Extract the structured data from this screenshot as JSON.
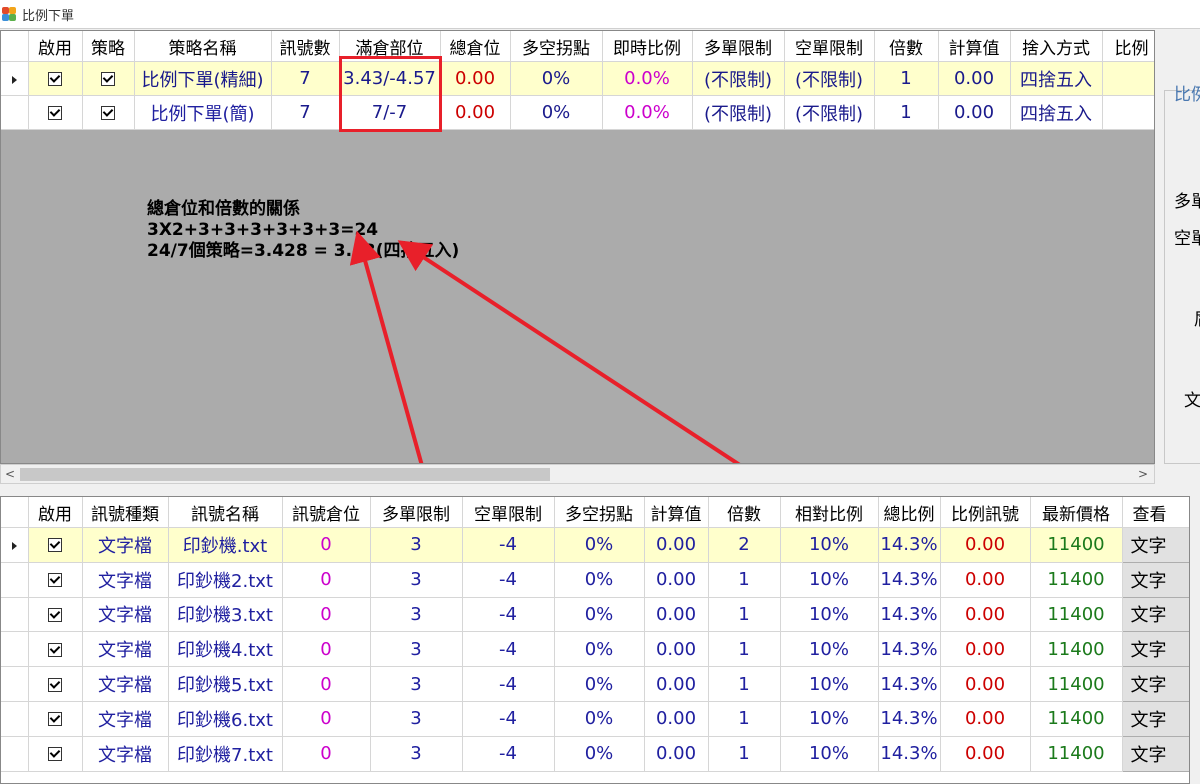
{
  "window": {
    "title": "比例下單"
  },
  "top_table": {
    "headers": [
      "啟用",
      "策略",
      "策略名稱",
      "訊號數",
      "滿倉部位",
      "總倉位",
      "多空拐點",
      "即時比例",
      "多單限制",
      "空單限制",
      "倍數",
      "計算值",
      "捨入方式",
      "比例"
    ],
    "rows": [
      [
        "",
        "",
        "比例下單(精細)",
        "7",
        "3.43/-4.57",
        "0.00",
        "0%",
        "0.0%",
        "(不限制)",
        "(不限制)",
        "1",
        "0.00",
        "四捨五入"
      ],
      [
        "",
        "",
        "比例下單(簡)",
        "7",
        "7/-7",
        "0.00",
        "0%",
        "0.0%",
        "(不限制)",
        "(不限制)",
        "1",
        "0.00",
        "四捨五入"
      ]
    ]
  },
  "annotation": {
    "line1": "總倉位和倍數的關係",
    "line2": "3X2+3+3+3+3+3+3=24",
    "line3": "24/7個策略=3.428 = 3.43(四捨五入)"
  },
  "right_panel": {
    "labels": [
      "比例",
      "多單",
      "空單",
      "屑",
      "文"
    ]
  },
  "bottom_table": {
    "headers": [
      "啟用",
      "訊號種類",
      "訊號名稱",
      "訊號倉位",
      "多單限制",
      "空單限制",
      "多空拐點",
      "計算值",
      "倍數",
      "相對比例",
      "總比例",
      "比例訊號",
      "最新價格",
      "查看"
    ],
    "rows": [
      [
        "文字檔",
        "印鈔機.txt",
        "0",
        "3",
        "-4",
        "0%",
        "0.00",
        "2",
        "10%",
        "14.3%",
        "0.00",
        "11400",
        "文字"
      ],
      [
        "文字檔",
        "印鈔機2.txt",
        "0",
        "3",
        "-4",
        "0%",
        "0.00",
        "1",
        "10%",
        "14.3%",
        "0.00",
        "11400",
        "文字"
      ],
      [
        "文字檔",
        "印鈔機3.txt",
        "0",
        "3",
        "-4",
        "0%",
        "0.00",
        "1",
        "10%",
        "14.3%",
        "0.00",
        "11400",
        "文字"
      ],
      [
        "文字檔",
        "印鈔機4.txt",
        "0",
        "3",
        "-4",
        "0%",
        "0.00",
        "1",
        "10%",
        "14.3%",
        "0.00",
        "11400",
        "文字"
      ],
      [
        "文字檔",
        "印鈔機5.txt",
        "0",
        "3",
        "-4",
        "0%",
        "0.00",
        "1",
        "10%",
        "14.3%",
        "0.00",
        "11400",
        "文字"
      ],
      [
        "文字檔",
        "印鈔機6.txt",
        "0",
        "3",
        "-4",
        "0%",
        "0.00",
        "1",
        "10%",
        "14.3%",
        "0.00",
        "11400",
        "文字"
      ],
      [
        "文字檔",
        "印鈔機7.txt",
        "0",
        "3",
        "-4",
        "0%",
        "0.00",
        "1",
        "10%",
        "14.3%",
        "0.00",
        "11400",
        "文字"
      ]
    ]
  },
  "colors": {
    "highlight": "#e8202a",
    "arrow": "#e8202a",
    "grid_bg": "#ababab",
    "selected_row": "#ffffcc"
  }
}
